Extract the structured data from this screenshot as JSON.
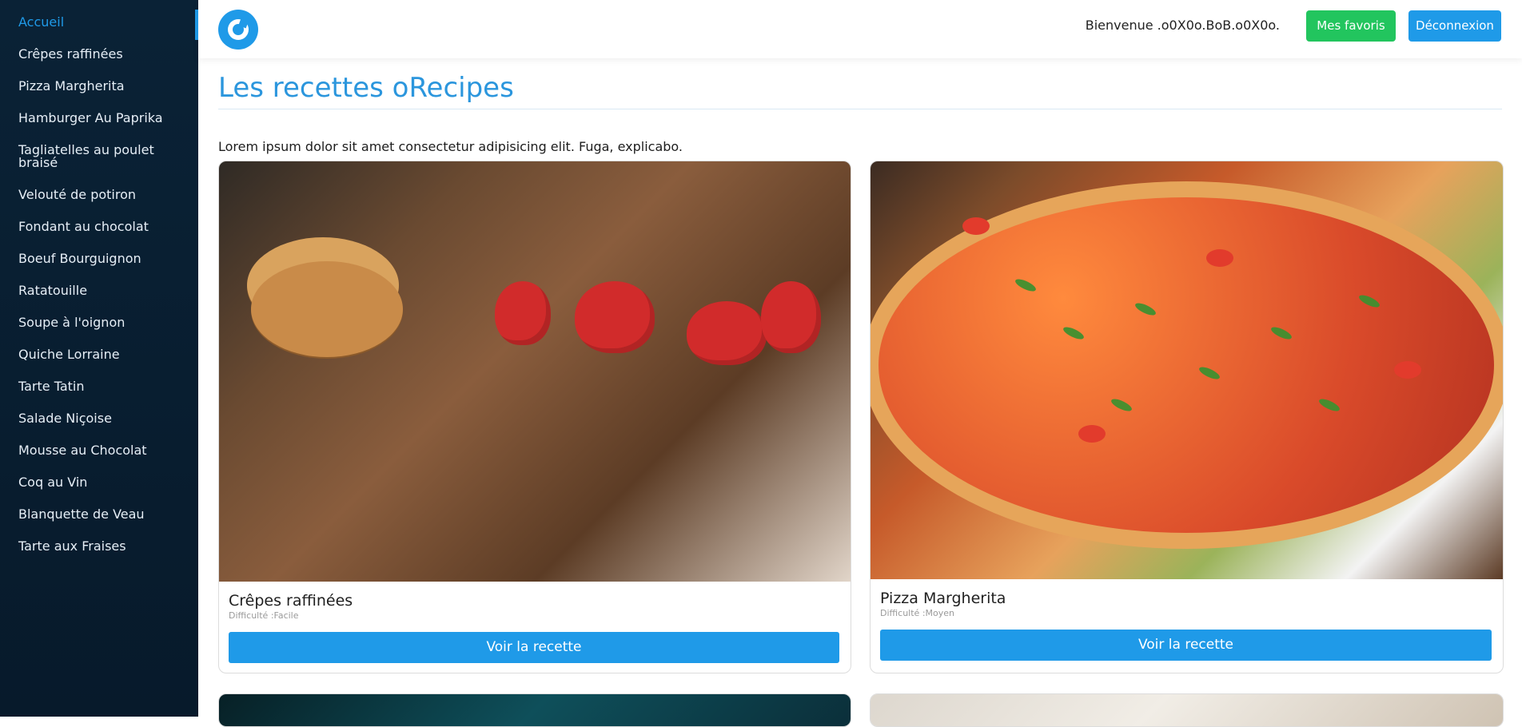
{
  "sidebar": {
    "items": [
      {
        "label": "Accueil",
        "active": true
      },
      {
        "label": "Crêpes raffinées"
      },
      {
        "label": "Pizza Margherita"
      },
      {
        "label": "Hamburger Au Paprika"
      },
      {
        "label": "Tagliatelles au poulet braisé"
      },
      {
        "label": "Velouté de potiron"
      },
      {
        "label": "Fondant au chocolat"
      },
      {
        "label": "Boeuf Bourguignon"
      },
      {
        "label": "Ratatouille"
      },
      {
        "label": "Soupe à l'oignon"
      },
      {
        "label": "Quiche Lorraine"
      },
      {
        "label": "Tarte Tatin"
      },
      {
        "label": "Salade Niçoise"
      },
      {
        "label": "Mousse au Chocolat"
      },
      {
        "label": "Coq au Vin"
      },
      {
        "label": "Blanquette de Veau"
      },
      {
        "label": "Tarte aux Fraises"
      }
    ]
  },
  "header": {
    "logo_icon": "orecipes-logo-icon",
    "welcome": "Bienvenue .o0X0o.BoB.o0X0o.",
    "favorites_label": "Mes favoris",
    "logout_label": "Déconnexion"
  },
  "main": {
    "title": "Les recettes oRecipes",
    "intro": "Lorem ipsum dolor sit amet consectetur adipisicing elit. Fuga, explicabo.",
    "cards": [
      {
        "title": "Crêpes raffinées",
        "difficulty": "Difficulté :Facile",
        "button": "Voir la recette",
        "image": "crepes-photo"
      },
      {
        "title": "Pizza Margherita",
        "difficulty": "Difficulté :Moyen",
        "button": "Voir la recette",
        "image": "pizza-photo"
      },
      {
        "image": "recipe-photo-3"
      },
      {
        "image": "recipe-photo-4"
      }
    ]
  },
  "colors": {
    "accent": "#1f9ae8",
    "favorites": "#22c55e",
    "sidebar": "#0a2236"
  }
}
